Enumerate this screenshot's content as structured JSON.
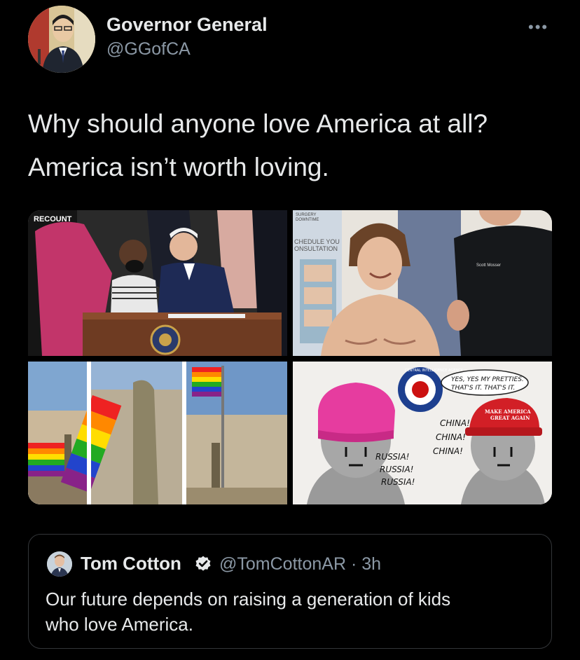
{
  "tweet": {
    "display_name": "Governor General",
    "handle": "@GGofCA",
    "more_label": "•••",
    "text_line1": "Why should anyone love America at all?",
    "text_line2": "America isn’t worth loving."
  },
  "media": {
    "top_left": {
      "overlay_label": "RECOUNT"
    },
    "top_right": {
      "sign_line1": "SURGERY",
      "sign_line2": "DOWNTIME",
      "sign_line3": "CHEDULE YOU",
      "sign_line4": "ONSULTATION",
      "badge_text": "Scott Mosser"
    },
    "bottom_right": {
      "seal_text": "CENTRAL INTELLIGENCE AGENCY",
      "speech_line1": "YES, YES MY PRETTIES.",
      "speech_line2": "THAT'S IT. THAT'S IT.",
      "hat_line1": "MAKE AMERICA",
      "hat_line2": "GREAT AGAIN",
      "right_chant": [
        "CHINA!",
        "CHINA!",
        "CHINA!"
      ],
      "left_chant": [
        "RUSSIA!",
        "RUSSIA!",
        "RUSSIA!"
      ]
    }
  },
  "quote": {
    "display_name": "Tom Cotton",
    "handle_time": "@TomCottonAR · 3h",
    "text_line1": "Our future depends on raising a generation of kids",
    "text_line2": "who love America."
  },
  "colors": {
    "background": "#000000",
    "text_primary": "#e7e9ea",
    "text_secondary": "#8b98a5",
    "border": "#333639"
  }
}
